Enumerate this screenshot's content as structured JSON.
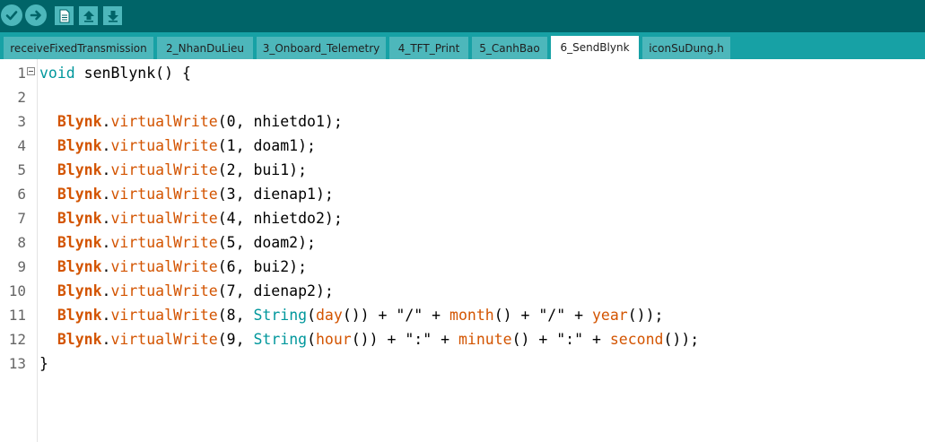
{
  "toolbar": {
    "buttons": [
      {
        "icon": "verify-check-icon"
      },
      {
        "icon": "upload-arrow-icon"
      },
      {
        "icon": "new-file-icon"
      },
      {
        "icon": "open-up-arrow-icon"
      },
      {
        "icon": "save-down-arrow-icon"
      }
    ]
  },
  "tabs": [
    {
      "label": "receiveFixedTransmission",
      "active": false
    },
    {
      "label": "2_NhanDuLieu",
      "active": false
    },
    {
      "label": "3_Onboard_Telemetry",
      "active": false
    },
    {
      "label": "4_TFT_Print",
      "active": false
    },
    {
      "label": "5_CanhBao",
      "active": false
    },
    {
      "label": "6_SendBlynk",
      "active": true
    },
    {
      "label": "iconSuDung.h",
      "active": false
    }
  ],
  "editor": {
    "line_numbers": [
      "1",
      "2",
      "3",
      "4",
      "5",
      "6",
      "7",
      "8",
      "9",
      "10",
      "11",
      "12",
      "13"
    ],
    "lines": [
      [
        {
          "t": "type",
          "s": "void"
        },
        {
          "t": "plain",
          "s": " senBlynk() {"
        }
      ],
      [],
      [
        {
          "t": "plain",
          "s": "  "
        },
        {
          "t": "blynk",
          "s": "Blynk"
        },
        {
          "t": "plain",
          "s": "."
        },
        {
          "t": "fn",
          "s": "virtualWrite"
        },
        {
          "t": "plain",
          "s": "(0, nhietdo1);"
        }
      ],
      [
        {
          "t": "plain",
          "s": "  "
        },
        {
          "t": "blynk",
          "s": "Blynk"
        },
        {
          "t": "plain",
          "s": "."
        },
        {
          "t": "fn",
          "s": "virtualWrite"
        },
        {
          "t": "plain",
          "s": "(1, doam1);"
        }
      ],
      [
        {
          "t": "plain",
          "s": "  "
        },
        {
          "t": "blynk",
          "s": "Blynk"
        },
        {
          "t": "plain",
          "s": "."
        },
        {
          "t": "fn",
          "s": "virtualWrite"
        },
        {
          "t": "plain",
          "s": "(2, bui1);"
        }
      ],
      [
        {
          "t": "plain",
          "s": "  "
        },
        {
          "t": "blynk",
          "s": "Blynk"
        },
        {
          "t": "plain",
          "s": "."
        },
        {
          "t": "fn",
          "s": "virtualWrite"
        },
        {
          "t": "plain",
          "s": "(3, dienap1);"
        }
      ],
      [
        {
          "t": "plain",
          "s": "  "
        },
        {
          "t": "blynk",
          "s": "Blynk"
        },
        {
          "t": "plain",
          "s": "."
        },
        {
          "t": "fn",
          "s": "virtualWrite"
        },
        {
          "t": "plain",
          "s": "(4, nhietdo2);"
        }
      ],
      [
        {
          "t": "plain",
          "s": "  "
        },
        {
          "t": "blynk",
          "s": "Blynk"
        },
        {
          "t": "plain",
          "s": "."
        },
        {
          "t": "fn",
          "s": "virtualWrite"
        },
        {
          "t": "plain",
          "s": "(5, doam2);"
        }
      ],
      [
        {
          "t": "plain",
          "s": "  "
        },
        {
          "t": "blynk",
          "s": "Blynk"
        },
        {
          "t": "plain",
          "s": "."
        },
        {
          "t": "fn",
          "s": "virtualWrite"
        },
        {
          "t": "plain",
          "s": "(6, bui2);"
        }
      ],
      [
        {
          "t": "plain",
          "s": "  "
        },
        {
          "t": "blynk",
          "s": "Blynk"
        },
        {
          "t": "plain",
          "s": "."
        },
        {
          "t": "fn",
          "s": "virtualWrite"
        },
        {
          "t": "plain",
          "s": "(7, dienap2);"
        }
      ],
      [
        {
          "t": "plain",
          "s": "  "
        },
        {
          "t": "blynk",
          "s": "Blynk"
        },
        {
          "t": "plain",
          "s": "."
        },
        {
          "t": "fn",
          "s": "virtualWrite"
        },
        {
          "t": "plain",
          "s": "(8, "
        },
        {
          "t": "lit",
          "s": "String"
        },
        {
          "t": "plain",
          "s": "("
        },
        {
          "t": "fn",
          "s": "day"
        },
        {
          "t": "plain",
          "s": "()) + \"/\" + "
        },
        {
          "t": "fn",
          "s": "month"
        },
        {
          "t": "plain",
          "s": "() + \"/\" + "
        },
        {
          "t": "fn",
          "s": "year"
        },
        {
          "t": "plain",
          "s": "());"
        }
      ],
      [
        {
          "t": "plain",
          "s": "  "
        },
        {
          "t": "blynk",
          "s": "Blynk"
        },
        {
          "t": "plain",
          "s": "."
        },
        {
          "t": "fn",
          "s": "virtualWrite"
        },
        {
          "t": "plain",
          "s": "(9, "
        },
        {
          "t": "lit",
          "s": "String"
        },
        {
          "t": "plain",
          "s": "("
        },
        {
          "t": "fn",
          "s": "hour"
        },
        {
          "t": "plain",
          "s": "()) + \":\" + "
        },
        {
          "t": "fn",
          "s": "minute"
        },
        {
          "t": "plain",
          "s": "() + \":\" + "
        },
        {
          "t": "fn",
          "s": "second"
        },
        {
          "t": "plain",
          "s": "());"
        }
      ],
      [
        {
          "t": "plain",
          "s": "}"
        }
      ]
    ]
  },
  "colors": {
    "toolbar_bg": "#006468",
    "tabbar_bg": "#17a1a5",
    "tab_bg": "#4db7bb",
    "keyword_type": "#00979c",
    "keyword_library": "#d35400"
  }
}
